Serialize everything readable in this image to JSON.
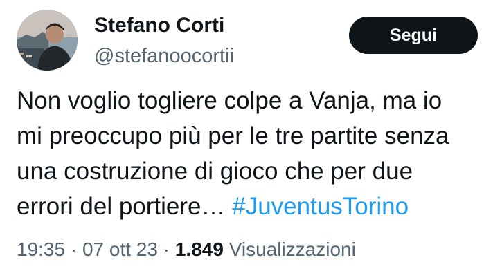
{
  "author": {
    "display_name": "Stefano Corti",
    "handle": "@stefanoocortii"
  },
  "follow_button": {
    "label": "Segui"
  },
  "tweet": {
    "lines": [
      "Non voglio togliere colpe a Vanja, ma io",
      "mi preoccupo più per le tre partite senza",
      "una costruzione di gioco che per due",
      "errori del portiere… "
    ],
    "hashtag": "#JuventusTorino"
  },
  "meta": {
    "time": "19:35",
    "sep1": " · ",
    "date": "07 ott 23",
    "sep2": " · ",
    "views_count": "1.849",
    "views_label": " Visualizzazioni"
  },
  "colors": {
    "link": "#1d9bf0",
    "secondary_text": "#536471",
    "follow_button_bg": "#0f1419"
  },
  "icons": {
    "avatar": "profile-photo"
  }
}
